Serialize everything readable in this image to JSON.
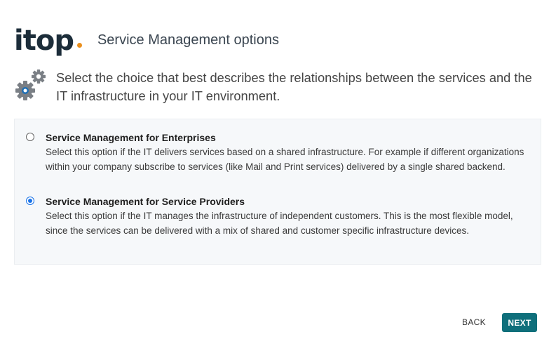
{
  "header": {
    "logo_text": "itop",
    "title": "Service Management options"
  },
  "intro": {
    "text": "Select the choice that best describes the relationships between the services and the IT infrastructure in your IT environment."
  },
  "options": [
    {
      "title": "Service Management for Enterprises",
      "description": "Select this option if the IT delivers services based on a shared infrastructure. For example if different organizations within your company subscribe to services (like Mail and Print services) delivered by a single shared backend.",
      "selected": false
    },
    {
      "title": "Service Management for Service Providers",
      "description": "Select this option if the IT manages the infrastructure of independent customers. This is the most flexible model, since the services can be delivered with a mix of shared and customer specific infrastructure devices.",
      "selected": true
    }
  ],
  "buttons": {
    "back_label": "BACK",
    "next_label": "NEXT"
  },
  "colors": {
    "logo_dot": "#ea8f1d",
    "gear_gray": "#7a7f85",
    "gear_blue": "#1f6fb5",
    "next_button": "#0f6f7b",
    "radio_selected": "#1a73e8"
  },
  "icons": {
    "intro": "gears-icon"
  }
}
